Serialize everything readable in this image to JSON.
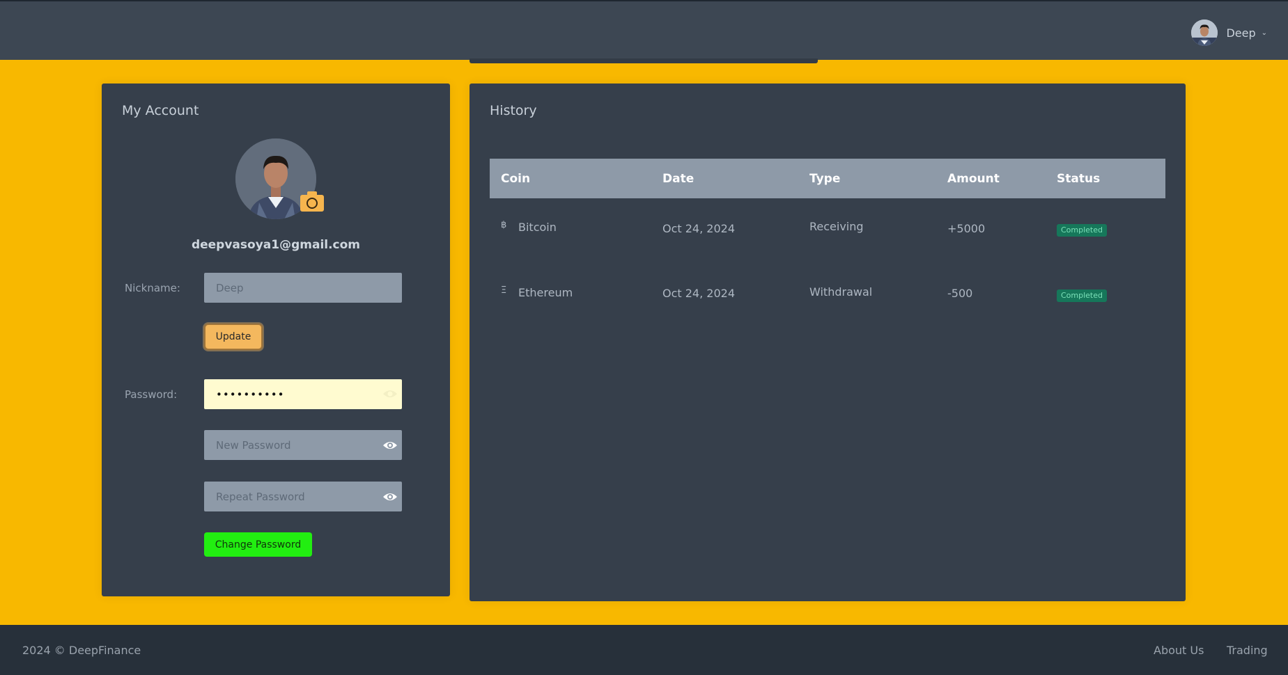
{
  "header": {
    "user_name": "Deep"
  },
  "account": {
    "title": "My Account",
    "email": "deepvasoya1@gmail.com",
    "nickname_label": "Nickname:",
    "nickname_value": "Deep",
    "update_label": "Update",
    "password_label": "Password:",
    "password_value": "••••••••••",
    "new_password_placeholder": "New Password",
    "repeat_password_placeholder": "Repeat Password",
    "change_password_label": "Change Password"
  },
  "history": {
    "title": "History",
    "columns": [
      "Coin",
      "Date",
      "Type",
      "Amount",
      "Status"
    ],
    "rows": [
      {
        "coin_symbol": "฿",
        "coin": "Bitcoin",
        "date": "Oct 24, 2024",
        "type": "Receiving",
        "amount": "+5000",
        "status": "Completed"
      },
      {
        "coin_symbol": "Ξ",
        "coin": "Ethereum",
        "date": "Oct 24, 2024",
        "type": "Withdrawal",
        "amount": "-500",
        "status": "Completed"
      }
    ]
  },
  "footer": {
    "copyright": "2024 © DeepFinance",
    "links": [
      "About Us",
      "Trading"
    ]
  },
  "colors": {
    "page_bg": "#f8b800",
    "navbar": "#3d4753",
    "card": "#363f4b",
    "accent_update": "#f4b85e",
    "accent_change": "#22ee11",
    "badge": "#16775a"
  }
}
